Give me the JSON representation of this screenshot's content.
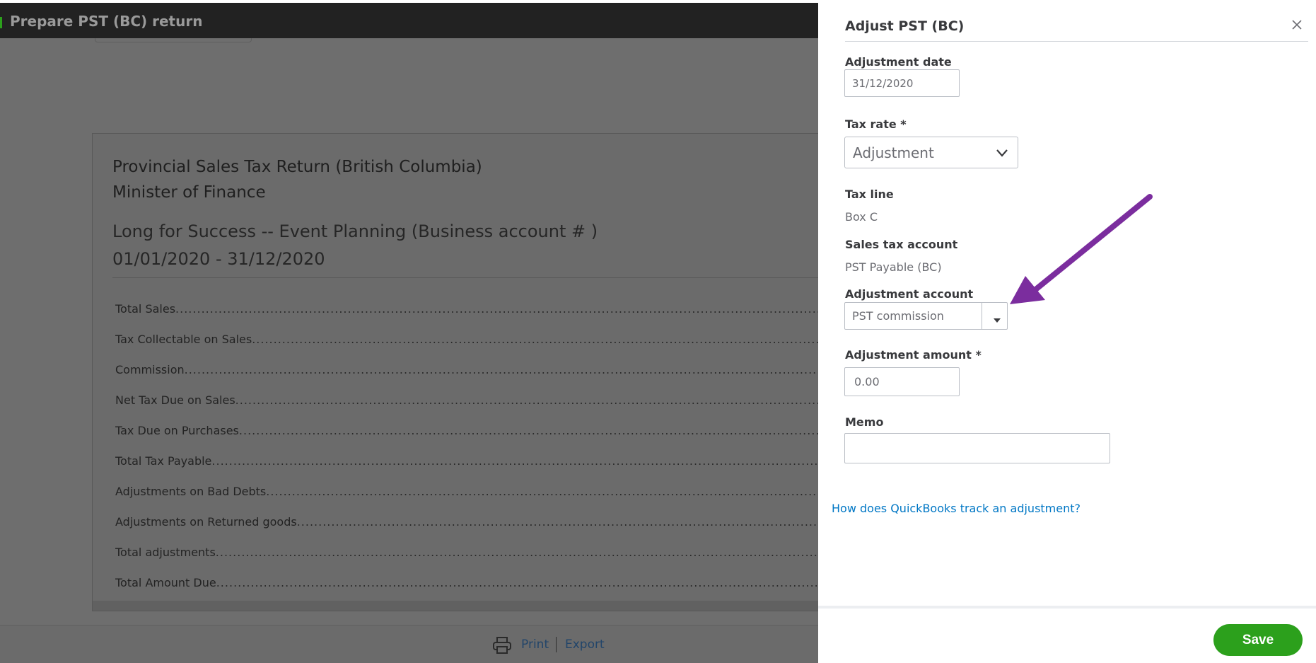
{
  "page": {
    "title": "Prepare PST (BC) return"
  },
  "report": {
    "title_line1": "Provincial Sales Tax Return (British Columbia)",
    "title_line2": "Minister of Finance",
    "company_line": "Long for Success -- Event Planning (Business account # )",
    "date_range": "01/01/2020 - 31/12/2020",
    "lines": [
      "Total Sales",
      "Tax Collectable on Sales",
      "Commission",
      "Net Tax Due on Sales",
      "Tax Due on Purchases",
      "Total Tax Payable",
      "Adjustments on Bad Debts",
      "Adjustments on Returned goods",
      "Total adjustments",
      "Total Amount Due"
    ]
  },
  "footer": {
    "print_label": "Print",
    "export_label": "Export",
    "print_icon": "printer-icon"
  },
  "panel": {
    "title": "Adjust PST (BC)",
    "close_icon": "close-icon",
    "adjustment_date_label": "Adjustment date",
    "adjustment_date_value": "31/12/2020",
    "tax_rate_label": "Tax rate *",
    "tax_rate_value": "Adjustment",
    "tax_line_label": "Tax line",
    "tax_line_value": "Box C",
    "sales_tax_account_label": "Sales tax account",
    "sales_tax_account_value": "PST Payable (BC)",
    "adjustment_account_label": "Adjustment account",
    "adjustment_account_value": "PST commission",
    "adjustment_amount_label": "Adjustment amount *",
    "adjustment_amount_value": "0.00",
    "memo_label": "Memo",
    "memo_value": "",
    "help_link": "How does QuickBooks track an adjustment?",
    "save_label": "Save"
  },
  "colors": {
    "brand_green": "#2ca01c",
    "link_blue": "#0077c5",
    "annotation_arrow": "#7b2d9e",
    "overlay_gray": "#6e6e6e"
  }
}
